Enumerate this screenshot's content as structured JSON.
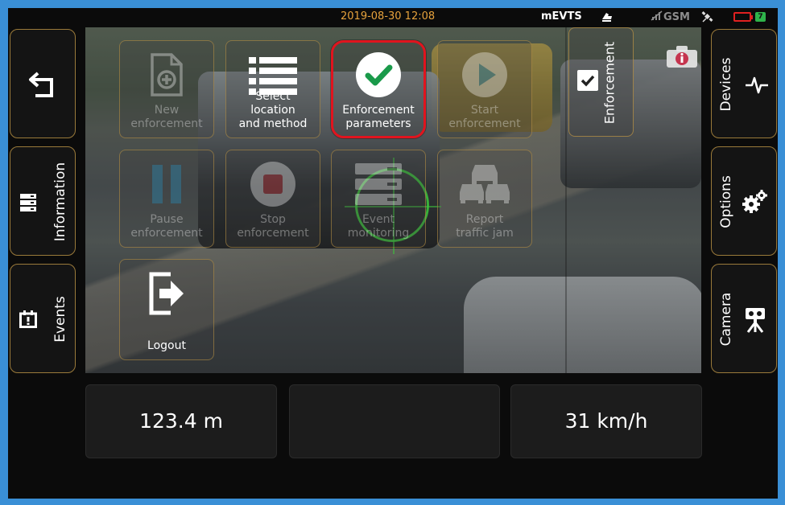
{
  "status_bar": {
    "datetime": "2019-08-30 12:08",
    "device_name": "mEVTS",
    "network": "GSM",
    "battery_secondary": "7",
    "icons": [
      "hand-icon",
      "gsm-signal-icon",
      "gps-satellite-icon",
      "battery-empty-icon",
      "battery-charging-icon"
    ]
  },
  "left_nav": {
    "back": {
      "icon": "back-arrow-icon"
    },
    "information": {
      "label": "Information",
      "icon": "server-list-icon"
    },
    "events": {
      "label": "Events",
      "icon": "calendar-alert-icon"
    }
  },
  "right_nav": {
    "devices": {
      "label": "Devices",
      "icon": "heartbeat-icon"
    },
    "options": {
      "label": "Options",
      "icon": "gears-icon"
    },
    "camera": {
      "label": "Camera",
      "icon": "camera-tripod-icon"
    }
  },
  "menu": {
    "new_enforcement": {
      "label": "New\nenforcement",
      "enabled": false
    },
    "select_location": {
      "label": "Select\nlocation\nand method",
      "enabled": true
    },
    "enforcement_parameters": {
      "label": "Enforcement\nparameters",
      "enabled": true,
      "highlighted": true
    },
    "start_enforcement": {
      "label": "Start\nenforcement",
      "enabled": false
    },
    "pause_enforcement": {
      "label": "Pause\nenforcement",
      "enabled": false
    },
    "stop_enforcement": {
      "label": "Stop\nenforcement",
      "enabled": false
    },
    "event_monitoring": {
      "label": "Event\nmonitoring",
      "enabled": false
    },
    "report_traffic_jam": {
      "label": "Report\ntraffic jam",
      "enabled": false
    },
    "logout": {
      "label": "Logout",
      "enabled": true
    }
  },
  "enforcement_panel": {
    "label": "Enforcement",
    "checked": true
  },
  "readouts": {
    "distance": "123.4 m",
    "middle": "",
    "speed": "31 km/h"
  },
  "colors": {
    "highlight_border": "#e0141e",
    "check_green": "#1a9a4a",
    "datetime": "#e6a23c",
    "tile_border": "#be9646"
  }
}
